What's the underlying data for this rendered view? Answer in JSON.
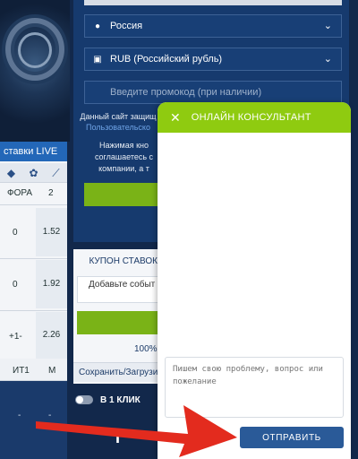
{
  "form": {
    "country": "Россия",
    "currency": "RUB (Российский рубль)",
    "promo_placeholder": "Введите промокод (при наличии)",
    "note_site": "Данный сайт защищ",
    "note_link": "Пользовательско",
    "note_agree_1": "Нажимая кно",
    "note_agree_2": "соглашаетесь с",
    "note_agree_3": "компании, а т"
  },
  "left": {
    "live_tab": "ставки LIVE",
    "col_fora": "ФОРА",
    "col_two": "2",
    "rows": [
      {
        "fora": "0",
        "val": "1.52"
      },
      {
        "fora": "0",
        "val": "1.92"
      },
      {
        "fora": "+1-",
        "val": "2.26"
      }
    ],
    "col_it1": "ИТ1",
    "col_m": "М",
    "dash_a": "-",
    "dash_b": "-"
  },
  "coupon": {
    "title": "КУПОН СТАВОК",
    "add_text": "Добавьте событ",
    "percent": "100%",
    "save_load": "Сохранить/Загрузи",
    "one_click": "В 1 КЛИК"
  },
  "chat": {
    "header": "ОНЛАЙН КОНСУЛЬТАНТ",
    "close_glyph": "✕",
    "input_placeholder": "Пишем свою проблему, вопрос или пожелание",
    "send_label": "ОТПРАВИТЬ"
  },
  "colors": {
    "accent_green": "#8fcb10",
    "primary_blue": "#2a5a98",
    "arrow_red": "#e32b1e"
  }
}
